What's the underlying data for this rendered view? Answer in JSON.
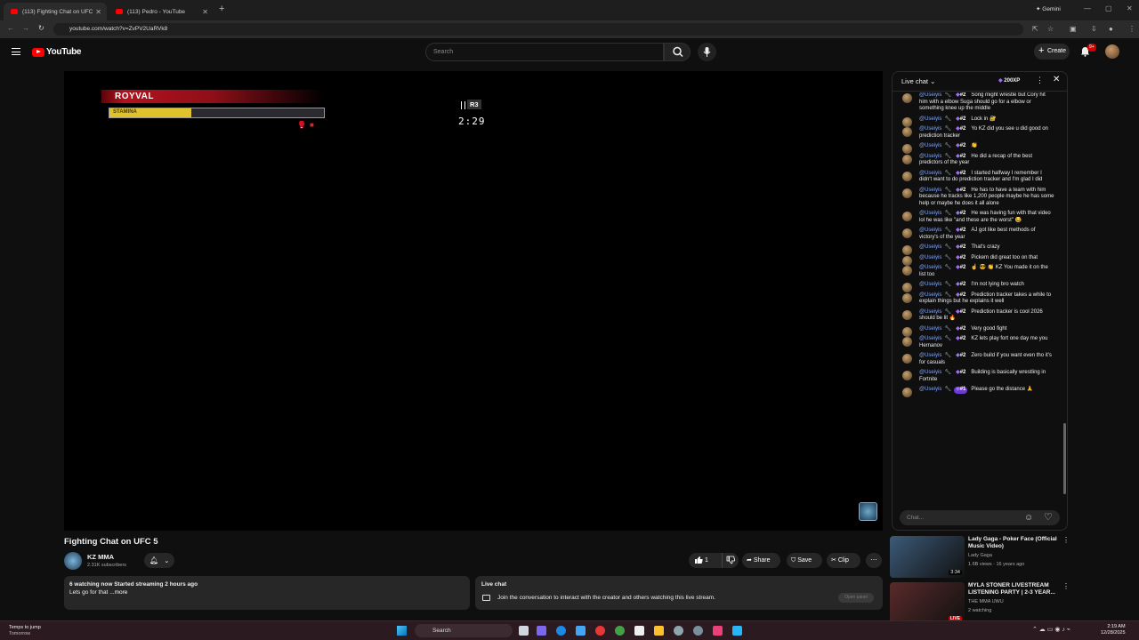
{
  "browser": {
    "tabs": [
      {
        "label": "(113) Fighting Chat on UFC",
        "active": true
      },
      {
        "label": "(113) Pedro - YouTube",
        "active": false
      }
    ],
    "gemini_label": "Gemini",
    "url": "youtube.com/watch?v=ZvPV2UaRVk8"
  },
  "youtube": {
    "logo_text": "YouTube",
    "search_placeholder": "Search",
    "create_label": "Create",
    "notification_count": "9+"
  },
  "video": {
    "hud_name": "ROYVAL",
    "stamina_label": "STAMINA",
    "stamina_fraction": 0.38,
    "round": "R3",
    "clock": "2:29",
    "title": "Fighting Chat on UFC 5"
  },
  "channel": {
    "name": "KZ MMA",
    "subscribers": "2.31K subscribers"
  },
  "actions": {
    "like_count": "1",
    "share": "Share",
    "save": "Save",
    "clip": "Clip"
  },
  "description": {
    "stats": "6 watching now  Started streaming 2 hours ago",
    "text": "Lets go for that",
    "more": "...more"
  },
  "live_chat_panel": {
    "title": "Live chat",
    "text": "Join the conversation to interact with the creator and others watching this live stream.",
    "open_label": "Open panel"
  },
  "chat": {
    "mode_label": "Live chat",
    "xp_label": "200XP",
    "input_placeholder": "Chat...",
    "messages": [
      {
        "author": "@Useiyis",
        "badge": "#2",
        "text": "Song might wrestle but Cory hit him with a elbow Suga should go for a elbow or something knee up the middle"
      },
      {
        "author": "@Useiyis",
        "badge": "#2",
        "text": "Lock in 🔐"
      },
      {
        "author": "@Useiyis",
        "badge": "#2",
        "text": "Yo KZ did you see u did good on prediction tracker"
      },
      {
        "author": "@Useiyis",
        "badge": "#2",
        "text": "👏"
      },
      {
        "author": "@Useiyis",
        "badge": "#2",
        "text": "He did a recap of the best predictors of the year"
      },
      {
        "author": "@Useiyis",
        "badge": "#2",
        "text": "I started halfway I remember I didn't want to do prediction tracker and I'm glad I did"
      },
      {
        "author": "@Useiyis",
        "badge": "#2",
        "text": "He has to have a team with him because he tracks like 1,200 people maybe he has some help or maybe he does it all alone"
      },
      {
        "author": "@Useiyis",
        "badge": "#2",
        "text": "He was having fun with that video lol he was like \"and these are the worst\" 😂"
      },
      {
        "author": "@Useiyis",
        "badge": "#2",
        "text": "AJ got like best methods of victory's of the year"
      },
      {
        "author": "@Useiyis",
        "badge": "#2",
        "text": "That's crazy"
      },
      {
        "author": "@Useiyis",
        "badge": "#2",
        "text": "Pickem did great too on that"
      },
      {
        "author": "@Useiyis",
        "badge": "#2",
        "text": "☝️ 😎 👏 KZ You made it on the list too"
      },
      {
        "author": "@Useiyis",
        "badge": "#2",
        "text": "I'm not lying bro watch"
      },
      {
        "author": "@Useiyis",
        "badge": "#2",
        "text": "Prediction tracker takes a while to explain things but he explains it well"
      },
      {
        "author": "@Useiyis",
        "badge": "#2",
        "text": "Prediction tracker is cool 2026 should be lit 🔥"
      },
      {
        "author": "@Useiyis",
        "badge": "#2",
        "text": "Very good fight"
      },
      {
        "author": "@Useiyis",
        "badge": "#2",
        "text": "KZ lets play fort one day me you Hernanov"
      },
      {
        "author": "@Useiyis",
        "badge": "#2",
        "text": "Zero build if you want even tho it's for casuals"
      },
      {
        "author": "@Useiyis",
        "badge": "#2",
        "text": "Building is basically wrestling in Fortnite"
      },
      {
        "author": "@Useiyis",
        "badge": "#1",
        "text": "Please go the distance 🙏",
        "highlight": true
      }
    ]
  },
  "recommendations": [
    {
      "title": "Lady Gaga - Poker Face (Official Music Video)",
      "channel": "Lady Gaga",
      "meta": "1.6B views · 16 years ago",
      "duration": "3:34",
      "thumb_color": "#3c5a78"
    },
    {
      "title": "MYLA STONER LIVESTREAM LISTENING PARTY | 2-3 YEAR...",
      "channel": "THE MMA UWU",
      "meta": "2 watching",
      "duration": "LIVE",
      "thumb_color": "#5a2a2a"
    }
  ],
  "taskbar": {
    "weather_title": "Temps to jump",
    "weather_sub": "Tomorrow",
    "search_label": "Search",
    "time": "2:19 AM",
    "date": "12/28/2025"
  }
}
